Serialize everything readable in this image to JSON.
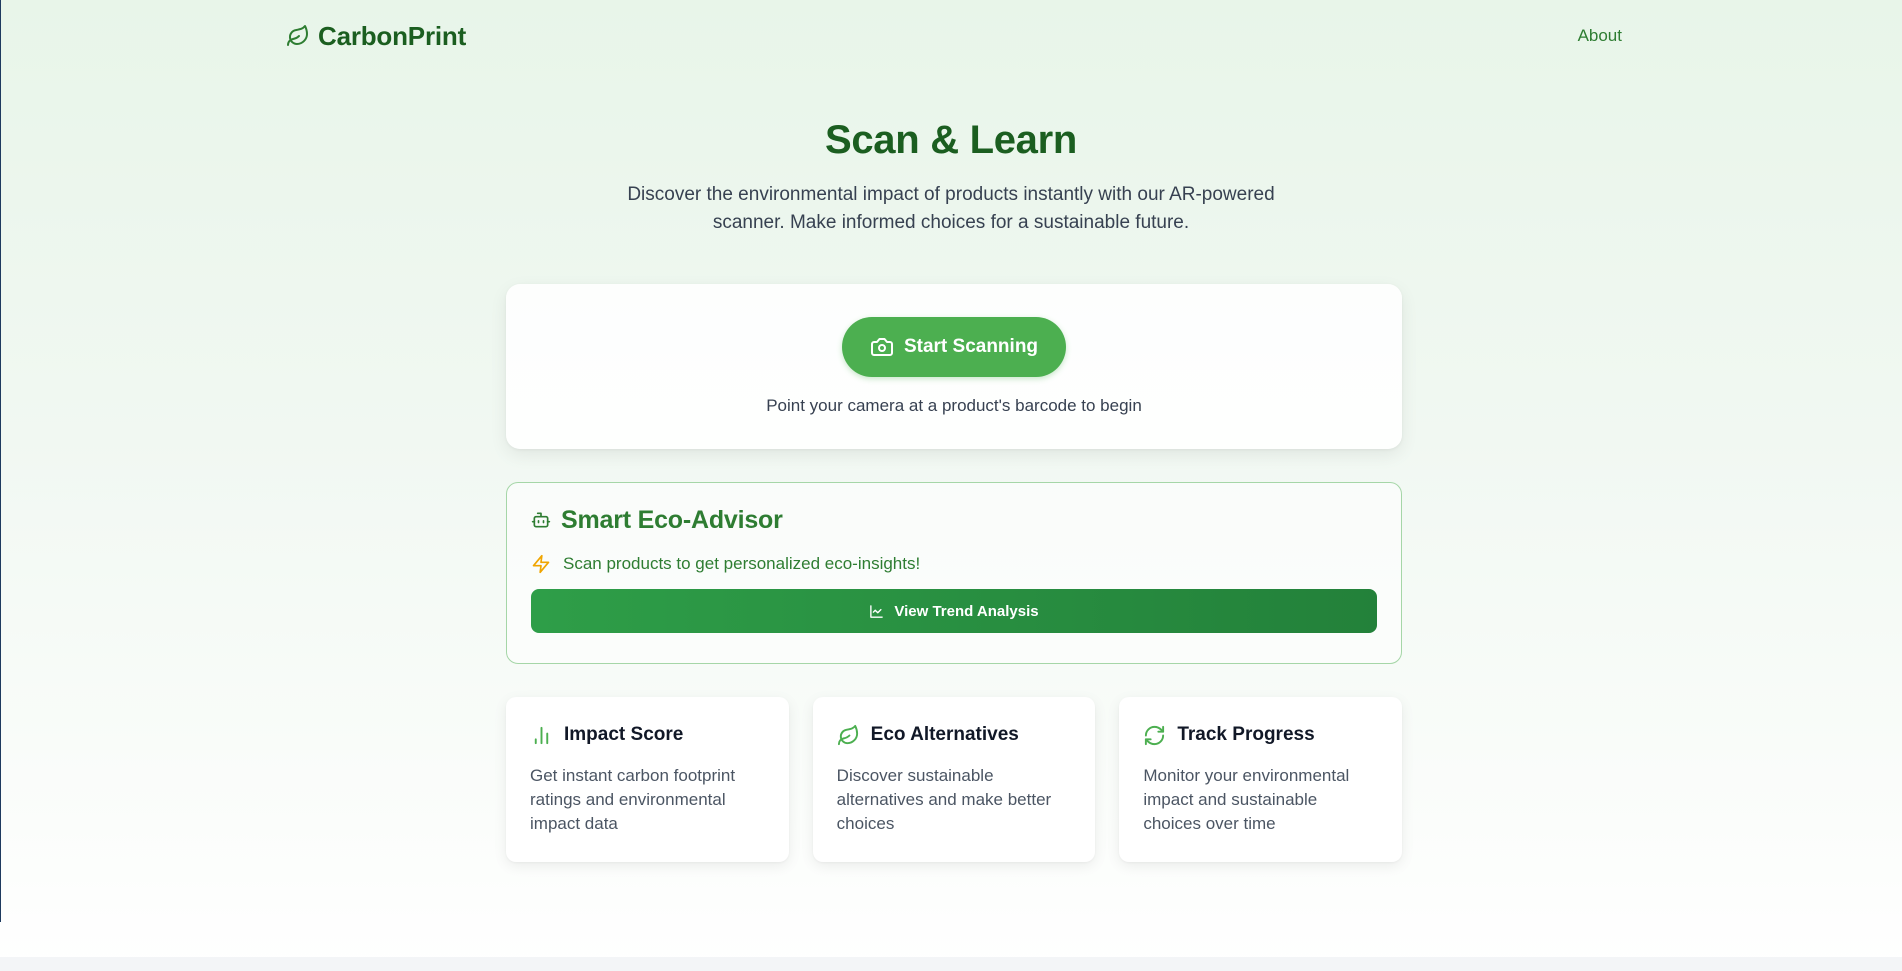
{
  "brand": {
    "name": "CarbonPrint",
    "logo_icon": "leaf-icon",
    "color": "#1b5e20"
  },
  "nav": {
    "about_label": "About"
  },
  "hero": {
    "title": "Scan & Learn",
    "subtitle": "Discover the environmental impact of products instantly with our AR-powered scanner. Make informed choices for a sustainable future."
  },
  "scanner": {
    "button_label": "Start Scanning",
    "button_icon": "camera-icon",
    "hint": "Point your camera at a product's barcode to begin",
    "accent": "#4caf50"
  },
  "advisor": {
    "icon": "robot-icon",
    "title": "Smart Eco-Advisor",
    "tip_icon": "lightning-icon",
    "tip": "Scan products to get personalized eco-insights!",
    "trend_button_label": "View Trend Analysis",
    "trend_button_icon": "line-chart-icon"
  },
  "features": [
    {
      "icon": "bar-chart-icon",
      "title": "Impact Score",
      "description": "Get instant carbon footprint ratings and environmental impact data"
    },
    {
      "icon": "leaf-icon",
      "title": "Eco Alternatives",
      "description": "Discover sustainable alternatives and make better choices"
    },
    {
      "icon": "refresh-icon",
      "title": "Track Progress",
      "description": "Monitor your environmental impact and sustainable choices over time"
    }
  ]
}
